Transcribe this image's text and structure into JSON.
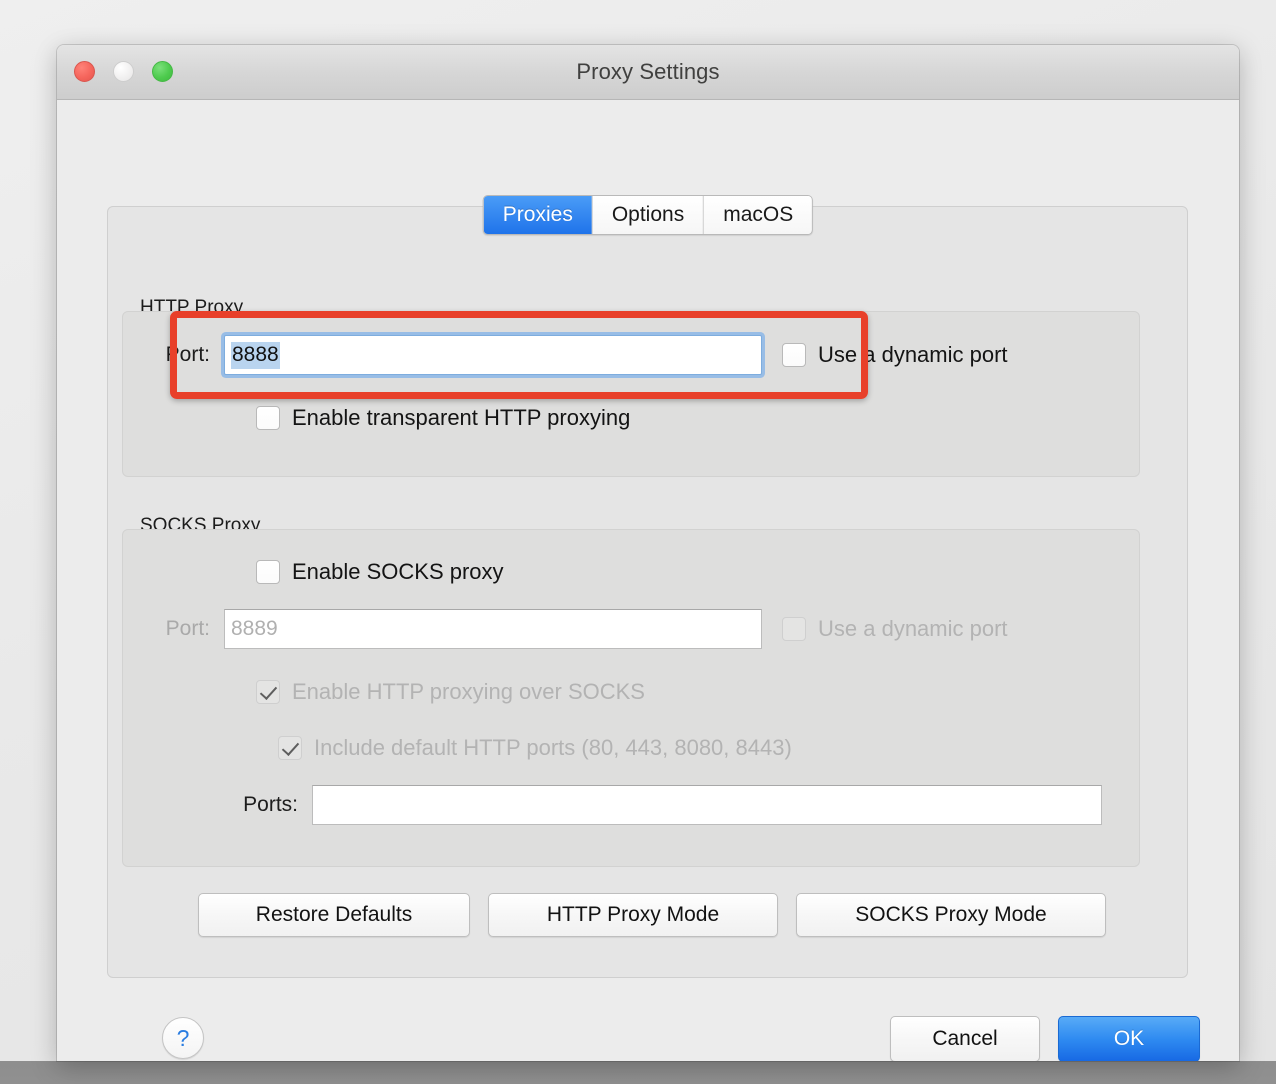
{
  "window": {
    "title": "Proxy Settings",
    "traffic_lights": [
      {
        "name": "close",
        "color": "#f5655c",
        "enabled": true
      },
      {
        "name": "minimize",
        "color": "#e6e5e5",
        "enabled": false
      },
      {
        "name": "maximize",
        "color": "#4ecb4e",
        "enabled": true
      }
    ]
  },
  "tabs": [
    {
      "label": "Proxies",
      "selected": true
    },
    {
      "label": "Options",
      "selected": false
    },
    {
      "label": "macOS",
      "selected": false
    }
  ],
  "http_proxy": {
    "group_label": "HTTP Proxy",
    "port_label": "Port:",
    "port_value": "8888",
    "port_selected": true,
    "port_focused": true,
    "dynamic_port_label": "Use a dynamic port",
    "dynamic_port_checked": false,
    "transparent_label": "Enable transparent HTTP proxying",
    "transparent_checked": false
  },
  "socks_proxy": {
    "group_label": "SOCKS Proxy",
    "enable_label": "Enable SOCKS proxy",
    "enable_checked": false,
    "port_label": "Port:",
    "port_placeholder": "8889",
    "port_value": "",
    "dynamic_port_label": "Use a dynamic port",
    "dynamic_port_checked": false,
    "http_over_socks_label": "Enable HTTP proxying over SOCKS",
    "http_over_socks_checked": true,
    "default_ports_label": "Include default HTTP ports (80, 443, 8080, 8443)",
    "default_ports_checked": true,
    "ports_label": "Ports:",
    "ports_value": ""
  },
  "mode_buttons": {
    "restore_defaults": "Restore Defaults",
    "http_proxy_mode": "HTTP Proxy Mode",
    "socks_proxy_mode": "SOCKS Proxy Mode"
  },
  "footer": {
    "help": "?",
    "cancel": "Cancel",
    "ok": "OK"
  },
  "annotation": {
    "color": "#e8402a",
    "target": "http-proxy-port-row"
  }
}
